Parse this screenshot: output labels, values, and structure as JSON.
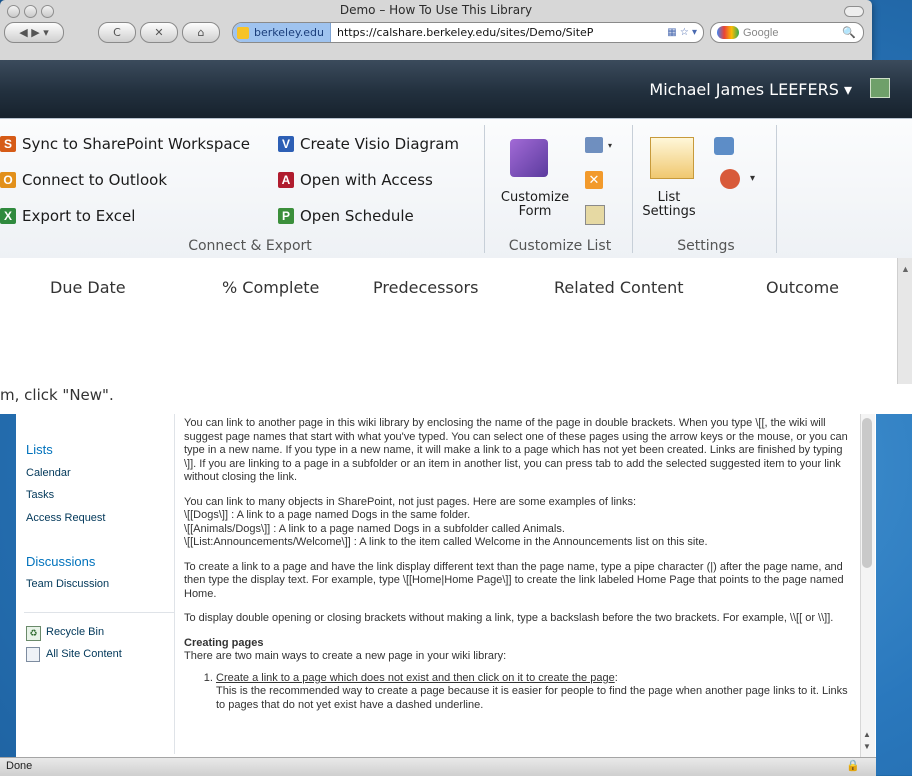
{
  "browser": {
    "window_title": "Demo – How To Use This Library",
    "site_identity": "berkeley.edu",
    "url": "https://calshare.berkeley.edu/sites/Demo/SiteP",
    "search_placeholder": "Google",
    "status": "Done"
  },
  "header": {
    "user_name": "Michael James LEEFERS ▾"
  },
  "ribbon": {
    "connect_export": {
      "label": "Connect & Export",
      "items": [
        "Sync to SharePoint Workspace",
        "Connect to Outlook",
        "Export to Excel",
        "Create Visio Diagram",
        "Open with Access",
        "Open Schedule"
      ],
      "letters": [
        "S",
        "O",
        "X",
        "V",
        "A",
        "P"
      ]
    },
    "customize_list": {
      "label": "Customize List",
      "customize_form": "Customize Form"
    },
    "settings": {
      "label": "Settings",
      "list_settings": "List Settings"
    }
  },
  "grid": {
    "columns": [
      "Due Date",
      "% Complete",
      "Predecessors",
      "Related Content",
      "Outcome"
    ],
    "empty_message": "m, click \"New\"."
  },
  "leftnav": {
    "lists_heading": "Lists",
    "lists": [
      "Calendar",
      "Tasks",
      "Access Request"
    ],
    "discussions_heading": "Discussions",
    "discussions": [
      "Team Discussion"
    ],
    "recycle_bin": "Recycle Bin",
    "all_site_content": "All Site Content"
  },
  "content": {
    "p1": "You can link to another page in this wiki library by enclosing the name of the page in double brackets. When you type \\[[, the wiki will suggest page names that start with what you've typed. You can select one of these pages using the arrow keys or the mouse, or you can type in a new name. If you type in a new name, it will make a link to a page which has not yet been created. Links are finished by typing \\]]. If you are linking to a page in a subfolder or an item in another list, you can press tab to add the selected suggested item to your link without closing the link.",
    "p2_intro": "You can link to many objects in SharePoint, not just pages. Here are some examples of links:",
    "p2_l1": "\\[[Dogs\\]] : A link to a page named Dogs in the same folder.",
    "p2_l2": "\\[[Animals/Dogs\\]] : A link to a page named Dogs in a subfolder called Animals.",
    "p2_l3": "\\[[List:Announcements/Welcome\\]] : A link to the item called Welcome in the Announcements list on this site.",
    "p3": "To create a link to a page and have the link display different text than the page name, type a pipe character (|) after the page name, and then type the display text. For example, type \\[[Home|Home Page\\]] to create the link labeled Home Page that points to the page named Home.",
    "p4": "To display double opening or closing brackets without making a link, type a backslash before the two brackets. For example, \\\\[[ or \\\\]].",
    "creating_heading": "Creating pages",
    "creating_intro": "There are two main ways to create a new page in your wiki library:",
    "step1_link": "Create a link to a page which does not exist and then click on it to create the page",
    "step1_text": "This is the recommended way to create a page because it is easier for people to find the page when another page links to it. Links to pages that do not yet exist have a dashed underline."
  }
}
